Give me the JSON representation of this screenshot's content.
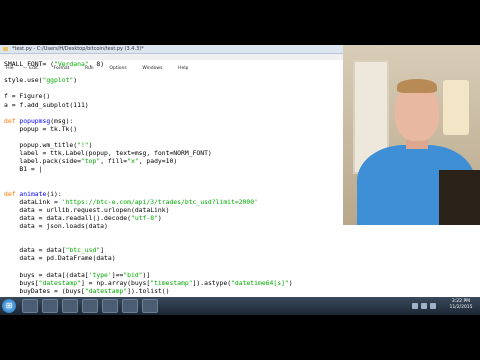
{
  "window": {
    "title": "*test.py - C:/Users/H/Desktop/bitcoin/test.py (3.4.3)*"
  },
  "menu": [
    "File",
    "Edit",
    "Format",
    "Run",
    "Options",
    "Windows",
    "Help"
  ],
  "code_lines": [
    {
      "html": "SMALL_FONT= (<span class=\"str\">\"Verdana\"</span>, 8)"
    },
    {
      "html": ""
    },
    {
      "html": "style.use(<span class=\"str\">\"ggplot\"</span>)"
    },
    {
      "html": ""
    },
    {
      "html": "f = Figure()"
    },
    {
      "html": "a = f.add_subplot(111)"
    },
    {
      "html": ""
    },
    {
      "html": "<span class=\"kw\">def</span> <span class=\"fn\">popupmsg</span>(msg):"
    },
    {
      "html": "    popup = tk.Tk()"
    },
    {
      "html": ""
    },
    {
      "html": "    popup.wm_title(<span class=\"str\">\"!\"</span>)"
    },
    {
      "html": "    label = ttk.Label(popup, text=msg, font=NORM_FONT)"
    },
    {
      "html": "    label.pack(side=<span class=\"str\">\"top\"</span>, fill=<span class=\"str\">\"x\"</span>, pady=10)"
    },
    {
      "html": "    B1 = |"
    },
    {
      "html": ""
    },
    {
      "html": ""
    },
    {
      "html": "<span class=\"kw\">def</span> <span class=\"fn\">animate</span>(i):"
    },
    {
      "html": "    dataLink = <span class=\"str\">'https://btc-e.com/api/3/trades/btc_usd?limit=2000'</span>"
    },
    {
      "html": "    data = urllib.request.urlopen(dataLink)"
    },
    {
      "html": "    data = data.readall().decode(<span class=\"str\">\"utf-8\"</span>)"
    },
    {
      "html": "    data = json.loads(data)"
    },
    {
      "html": ""
    },
    {
      "html": ""
    },
    {
      "html": "    data = data[<span class=\"str\">\"btc_usd\"</span>]"
    },
    {
      "html": "    data = pd.DataFrame(data)"
    },
    {
      "html": ""
    },
    {
      "html": "    buys = data[(data[<span class=\"str\">'type'</span>]==<span class=\"str\">\"bid\"</span>)]"
    },
    {
      "html": "    buys[<span class=\"str\">\"datestamp\"</span>] = np.array(buys[<span class=\"str\">\"timestamp\"</span>]).astype(<span class=\"str\">\"datetime64[s]\"</span>)"
    },
    {
      "html": "    buyDates = (buys[<span class=\"str\">\"datestamp\"</span>]).tolist()"
    }
  ],
  "icons": {
    "window_icon": "python-file-icon",
    "start": "windows-start-icon",
    "minimize": "minimize-icon",
    "maximize": "maximize-icon",
    "close": "close-icon"
  },
  "taskbar": {
    "start_glyph": "⊞",
    "clock_time": "3:22 PM",
    "clock_date": "11/2/2015"
  }
}
